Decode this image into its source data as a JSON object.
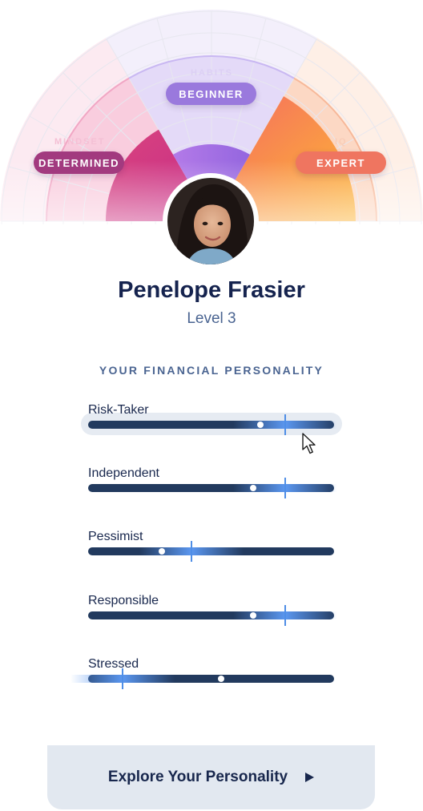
{
  "radial": {
    "dimensions": [
      {
        "axis": "MINDSET",
        "value": "DETERMINED",
        "color": "#a23a7f"
      },
      {
        "axis": "HABITS",
        "value": "BEGINNER",
        "color": "#9a79dd"
      },
      {
        "axis": "IQ",
        "value": "EXPERT",
        "color": "#ef7560"
      }
    ]
  },
  "profile": {
    "name": "Penelope Frasier",
    "level": "Level 3"
  },
  "personality": {
    "title": "YOUR FINANCIAL PERSONALITY",
    "traits": [
      {
        "label": "Risk-Taker",
        "marker": 0.8,
        "score": 0.7,
        "active": true
      },
      {
        "label": "Independent",
        "marker": 0.8,
        "score": 0.67,
        "active": false
      },
      {
        "label": "Pessimist",
        "marker": 0.42,
        "score": 0.3,
        "active": false
      },
      {
        "label": "Responsible",
        "marker": 0.8,
        "score": 0.67,
        "active": false
      },
      {
        "label": "Stressed",
        "marker": 0.14,
        "score": 0.54,
        "active": false
      }
    ]
  },
  "cta": {
    "label": "Explore Your Personality",
    "icon": "play-icon"
  },
  "colors": {
    "navy": "#15234e",
    "track": "#223a5e",
    "accent_blue": "#5b97f0",
    "button_bg": "#e2e8f0"
  }
}
